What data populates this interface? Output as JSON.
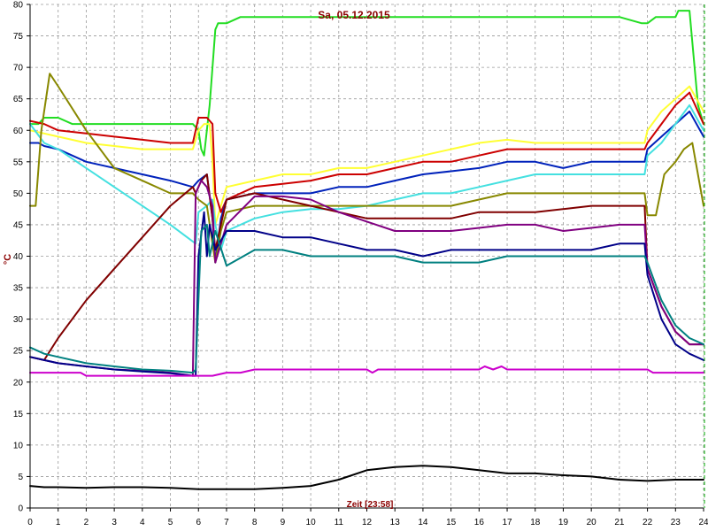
{
  "chart_data": {
    "type": "line",
    "title": "Sa, 05.12.2015",
    "xlabel": "Zeit [23:58]",
    "ylabel": "°C",
    "xlim": [
      0,
      24
    ],
    "ylim": [
      0,
      80
    ],
    "xticks": [
      "0",
      "1",
      "2",
      "3",
      "4",
      "5",
      "6",
      "7",
      "8",
      "9",
      "10",
      "11",
      "12",
      "13",
      "14",
      "15",
      "16",
      "17",
      "18",
      "19",
      "20",
      "21",
      "22",
      "23",
      "24"
    ],
    "yticks": [
      "0",
      "5",
      "10",
      "15",
      "20",
      "25",
      "30",
      "35",
      "40",
      "45",
      "50",
      "55",
      "60",
      "65",
      "70",
      "75",
      "80"
    ],
    "grid": true,
    "series": [
      {
        "color": "#22dd22",
        "x": [
          0,
          0.3,
          0.5,
          1,
          1.5,
          2,
          3,
          4,
          5,
          5.8,
          6.0,
          6.1,
          6.2,
          6.4,
          6.6,
          6.7,
          7,
          7.5,
          9,
          10,
          12,
          16,
          19,
          21,
          21.8,
          22,
          22.3,
          23,
          23.1,
          23.5,
          23.8,
          24
        ],
        "y": [
          61,
          61,
          62,
          62,
          61,
          61,
          61,
          61,
          61,
          61,
          60,
          57,
          56,
          64,
          76,
          77,
          77,
          78,
          78,
          78,
          78,
          78,
          78,
          78,
          77,
          77,
          78,
          78,
          79,
          79,
          64,
          61
        ]
      },
      {
        "color": "#ffff33",
        "x": [
          0,
          0.5,
          1,
          2,
          3,
          4,
          5,
          5.8,
          6.0,
          6.2,
          6.4,
          6.5,
          6.6,
          6.8,
          7,
          8,
          9,
          10,
          11,
          12,
          13,
          14,
          15,
          16,
          17,
          18,
          19,
          20,
          21,
          21.9,
          22,
          22.5,
          23,
          23.5,
          24
        ],
        "y": [
          60,
          59.5,
          59,
          58,
          57.5,
          57,
          57,
          57,
          60,
          61,
          61,
          55,
          45,
          48,
          51,
          52,
          53,
          53,
          54,
          54,
          55,
          56,
          57,
          58,
          58.5,
          58,
          58,
          58,
          58,
          58,
          60,
          63,
          65,
          67,
          63
        ]
      },
      {
        "color": "#cc0000",
        "x": [
          0,
          0.5,
          1,
          2,
          3,
          4,
          5,
          5.8,
          6.0,
          6.3,
          6.5,
          6.6,
          6.8,
          7,
          8,
          9,
          10,
          11,
          12,
          13,
          14,
          15,
          16,
          17,
          18,
          19,
          20,
          21,
          21.9,
          22,
          22.5,
          23,
          23.5,
          24
        ],
        "y": [
          61.5,
          61,
          60,
          59.5,
          59,
          58.5,
          58,
          58,
          62,
          62,
          61,
          50,
          47,
          49,
          51,
          51.5,
          52,
          53,
          53,
          54,
          55,
          55,
          56,
          57,
          57,
          57,
          57,
          57,
          57,
          58,
          61,
          64,
          66,
          61
        ]
      },
      {
        "color": "#0022bb",
        "x": [
          0,
          0.3,
          0.5,
          1,
          2,
          3,
          4,
          5,
          5.8,
          6.0,
          6.3,
          6.5,
          6.6,
          6.8,
          7,
          8,
          9,
          10,
          11,
          12,
          13,
          14,
          15,
          16,
          17,
          18,
          19,
          20,
          21,
          21.9,
          22,
          22.5,
          23,
          23.5,
          24
        ],
        "y": [
          58,
          58,
          57.5,
          57,
          55,
          54,
          53,
          52,
          51,
          52,
          53,
          46,
          39,
          46,
          49,
          50,
          50,
          50,
          51,
          51,
          52,
          53,
          53.5,
          54,
          55,
          55,
          54,
          55,
          55,
          55,
          57,
          59,
          61,
          63,
          59
        ]
      },
      {
        "color": "#44e0e0",
        "x": [
          0,
          0.5,
          1,
          2,
          3,
          4,
          5,
          5.9,
          6.0,
          6.3,
          6.5,
          6.6,
          6.8,
          7,
          8,
          9,
          10,
          11,
          12,
          13,
          14,
          15,
          16,
          17,
          18,
          19,
          20,
          21,
          21.9,
          22,
          22.5,
          23,
          23.5,
          24
        ],
        "y": [
          61,
          58,
          57,
          54,
          51,
          48,
          45,
          42,
          47,
          48,
          49,
          45,
          41,
          44,
          46,
          47,
          47.5,
          47.5,
          48,
          49,
          50,
          50,
          51,
          52,
          53,
          53,
          53,
          53,
          53,
          56,
          58,
          61,
          64,
          60
        ]
      },
      {
        "color": "#888800",
        "x": [
          0,
          0.2,
          0.4,
          0.7,
          1,
          2,
          3,
          4,
          5,
          5.8,
          6.0,
          6.3,
          6.5,
          6.6,
          6.8,
          7,
          8,
          9,
          10,
          11,
          12,
          13,
          14,
          15,
          16,
          17,
          18,
          19,
          20,
          21,
          21.9,
          22,
          22.3,
          22.6,
          23,
          23.3,
          23.6,
          24
        ],
        "y": [
          48,
          48,
          60,
          69,
          67,
          60,
          54,
          52,
          50,
          50,
          49,
          48,
          42,
          39,
          44,
          47,
          48,
          48,
          48,
          48,
          48,
          48,
          48,
          48,
          49,
          50,
          50,
          50,
          50,
          50,
          50,
          46.5,
          46.5,
          53,
          55,
          57,
          58,
          48
        ]
      },
      {
        "color": "#800000",
        "x": [
          0,
          0.5,
          1,
          2,
          3,
          4,
          5,
          5.8,
          5.9,
          6.1,
          6.3,
          6.5,
          6.6,
          7,
          8,
          9,
          10,
          11,
          12,
          13,
          14,
          15,
          16,
          17,
          18,
          19,
          20,
          21,
          21.9,
          22,
          22.5,
          23,
          23.5,
          24
        ],
        "y": [
          24,
          23.5,
          27,
          33,
          38,
          43,
          48,
          51,
          50,
          52,
          53,
          46,
          41,
          49,
          50,
          49,
          48,
          47,
          46,
          46,
          46,
          46,
          47,
          47,
          47,
          47.5,
          48,
          48,
          48,
          38,
          32,
          28,
          26,
          26
        ]
      },
      {
        "color": "#800080",
        "x": [
          0,
          0.5,
          1,
          2,
          3,
          4,
          5,
          5.8,
          5.9,
          6.1,
          6.3,
          6.5,
          6.6,
          7,
          8,
          9,
          10,
          11,
          12,
          13,
          14,
          15,
          16,
          17,
          18,
          19,
          20,
          21,
          21.9,
          22,
          22.5,
          23,
          23.5,
          24
        ],
        "y": [
          24,
          23.5,
          23,
          22.5,
          22,
          21.8,
          21.5,
          21,
          50,
          52,
          51,
          48,
          39,
          45,
          49.5,
          49.5,
          49,
          47,
          45.5,
          44,
          44,
          44,
          44.5,
          45,
          45,
          44,
          44.5,
          45,
          45,
          38,
          32,
          28,
          26,
          26
        ]
      },
      {
        "color": "#000088",
        "x": [
          0,
          0.5,
          1,
          2,
          3,
          4,
          5,
          5.8,
          5.9,
          6.0,
          6.2,
          6.3,
          6.4,
          6.6,
          7,
          8,
          9,
          10,
          11,
          12,
          13,
          14,
          15,
          16,
          17,
          18,
          19,
          20,
          21,
          21.9,
          22,
          22.5,
          23,
          23.5,
          24
        ],
        "y": [
          24,
          23.5,
          23,
          22.5,
          22,
          21.7,
          21.4,
          21,
          21,
          40,
          47,
          40,
          45,
          41,
          44,
          44,
          43,
          43,
          42,
          41,
          41,
          40,
          41,
          41,
          41,
          41,
          41,
          41,
          42,
          42,
          37,
          30,
          26,
          24.5,
          23.5
        ]
      },
      {
        "color": "#008080",
        "x": [
          0,
          0.5,
          1,
          2,
          3,
          4,
          5,
          5.8,
          5.9,
          6.1,
          6.3,
          6.4,
          6.6,
          7,
          8,
          9,
          10,
          11,
          12,
          13,
          14,
          15,
          16,
          17,
          18,
          19,
          20,
          21,
          21.9,
          22,
          22.5,
          23,
          23.5,
          24
        ],
        "y": [
          25.5,
          24.5,
          24,
          23,
          22.5,
          22,
          21.8,
          21.5,
          22,
          44,
          45,
          40,
          44,
          38.5,
          41,
          41,
          40,
          40,
          40,
          40,
          39,
          39,
          39,
          40,
          40,
          40,
          40,
          40,
          40,
          39,
          33,
          29,
          27,
          26
        ]
      },
      {
        "color": "#cc00cc",
        "x": [
          0,
          1,
          1.8,
          2,
          4,
          6,
          6.5,
          7,
          7.5,
          8,
          12,
          12.2,
          12.4,
          16,
          16.2,
          16.5,
          16.8,
          17,
          20,
          21,
          22,
          22.2,
          24
        ],
        "y": [
          21.5,
          21.5,
          21.5,
          21,
          21,
          21,
          21,
          21.5,
          21.5,
          22,
          22,
          21.5,
          22,
          22,
          22.5,
          22,
          22.5,
          22,
          22,
          22,
          22,
          21.5,
          21.5
        ]
      },
      {
        "color": "#000000",
        "x": [
          0,
          0.5,
          1,
          2,
          3,
          4,
          5,
          6,
          7,
          8,
          9,
          10,
          11,
          12,
          13,
          14,
          15,
          16,
          17,
          18,
          19,
          20,
          21,
          22,
          23,
          24
        ],
        "y": [
          3.5,
          3.3,
          3.3,
          3.2,
          3.3,
          3.3,
          3.2,
          3.0,
          3.0,
          3.0,
          3.2,
          3.5,
          4.5,
          6.0,
          6.5,
          6.7,
          6.5,
          6.0,
          5.5,
          5.5,
          5.2,
          5.0,
          4.5,
          4.3,
          4.5,
          4.5
        ]
      }
    ]
  }
}
